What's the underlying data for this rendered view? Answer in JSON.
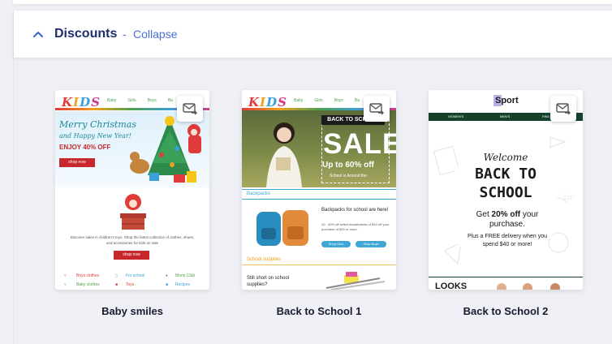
{
  "section": {
    "title": "Discounts",
    "separator": "-",
    "collapse_label": "Collapse"
  },
  "templates": [
    {
      "name": "Baby smiles",
      "logo": "KIDS",
      "nav": [
        "Baby",
        "Girls",
        "Boys",
        "Ba"
      ],
      "hero_title": "Merry Christmas",
      "hero_sub": "and Happy New Year!",
      "hero_offer": "ENJOY 40% OFF",
      "hero_button": "shop now",
      "body_text": "Discover sales in children's toys. Shop the latest collection of clothes, shoes, and accessories for kids on sale",
      "body_button": "shop now",
      "categories": [
        "Boys clothes",
        "For school",
        "Mono Club",
        "Baby clothes",
        "Toys",
        "Recipes"
      ]
    },
    {
      "name": "Back to School 1",
      "logo": "KIDS",
      "nav": [
        "Baby",
        "Girls",
        "Boys",
        "Ba"
      ],
      "hero_badge": "BACK TO SCHOOL",
      "hero_sale": "SALE",
      "hero_offer": "Up to 60% off",
      "hero_small": "School is Around the",
      "section1": "Backpacks",
      "backpacks_title": "Backpacks for school are here!",
      "backpacks_text": "20 - 30% off select departments or $10 off your purchase of $25 or more.",
      "btn_girls": "Shop Girls",
      "btn_boys": "Shop Boys",
      "section2": "School supplies",
      "supplies_text": "Still short on school supplies?"
    },
    {
      "name": "Back to School 2",
      "logo": "Sport",
      "nav": [
        "WOMEN'S",
        "MEN'S",
        "FIND"
      ],
      "welcome": "Welcome",
      "headline1": "BACK TO",
      "headline2": "SCHOOL",
      "offer_pre": "Get ",
      "offer_bold": "20% off",
      "offer_post": " your purchase.",
      "delivery": "Plus a FREE delivery when you spend $40 or more!",
      "chalk_note": "2πr",
      "section": "LOOKS"
    }
  ],
  "colors": {
    "title": "#1f2e6e",
    "link": "#4a6fd8",
    "chalkboard": "#1f5a3a",
    "kids_red": "#e03a3a",
    "school_blue": "#3fa7d6"
  }
}
